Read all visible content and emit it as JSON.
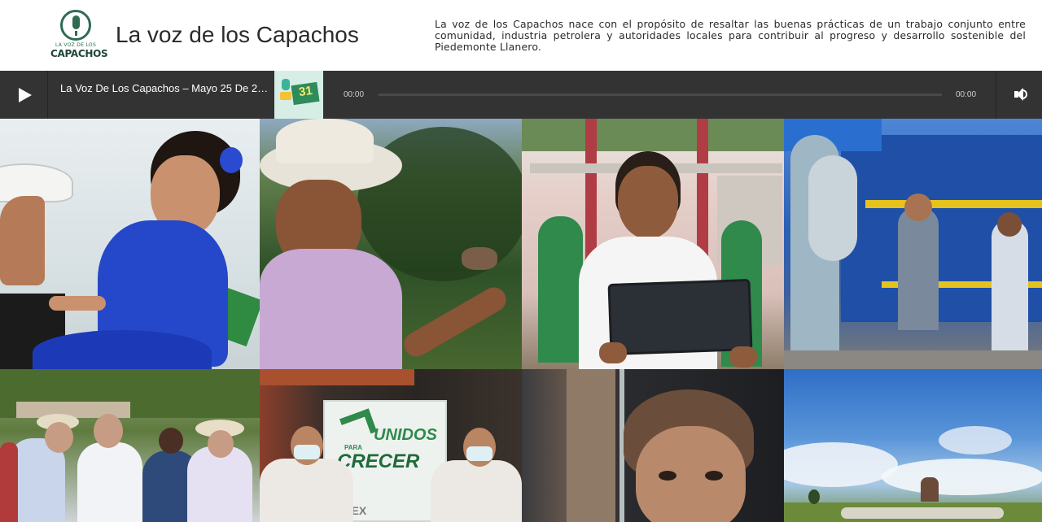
{
  "header": {
    "logo_small_text": "LA VOZ DE LOS",
    "logo_big_text": "CAPACHOS",
    "title": "La voz de los Capachos",
    "description": "La voz de los Capachos nace con el propósito de resaltar las buenas prácticas de un trabajo conjunto entre comunidad, industria petrolera y autoridades locales para contribuir al progreso y desarrollo sostenible del Piedemonte Llanero."
  },
  "player": {
    "track_title": "La Voz De Los Capachos – Mayo 25 De 2…",
    "thumbnail_number": "31",
    "current_time": "00:00",
    "duration": "00:00",
    "progress": 0,
    "icons": [
      "play-icon",
      "volume-icon"
    ]
  },
  "gallery": {
    "tiles": [
      {
        "label": "girl-dancing-blue-dress"
      },
      {
        "label": "man-cowboy-hat"
      },
      {
        "label": "boy-with-tablet"
      },
      {
        "label": "workers-at-facility"
      },
      {
        "label": "group-of-people-outdoors"
      },
      {
        "label": "men-unidos-para-crecer-banner",
        "banner_line1": "UNIDOS",
        "banner_line2": "PARA",
        "banner_line3": "CRECER",
        "banner_brand": "PAREX"
      },
      {
        "label": "girl-with-water"
      },
      {
        "label": "cattle-landscape"
      }
    ]
  },
  "colors": {
    "brand_green": "#2f6b52",
    "player_bg": "#333333",
    "title_text": "#2b2b2b"
  }
}
